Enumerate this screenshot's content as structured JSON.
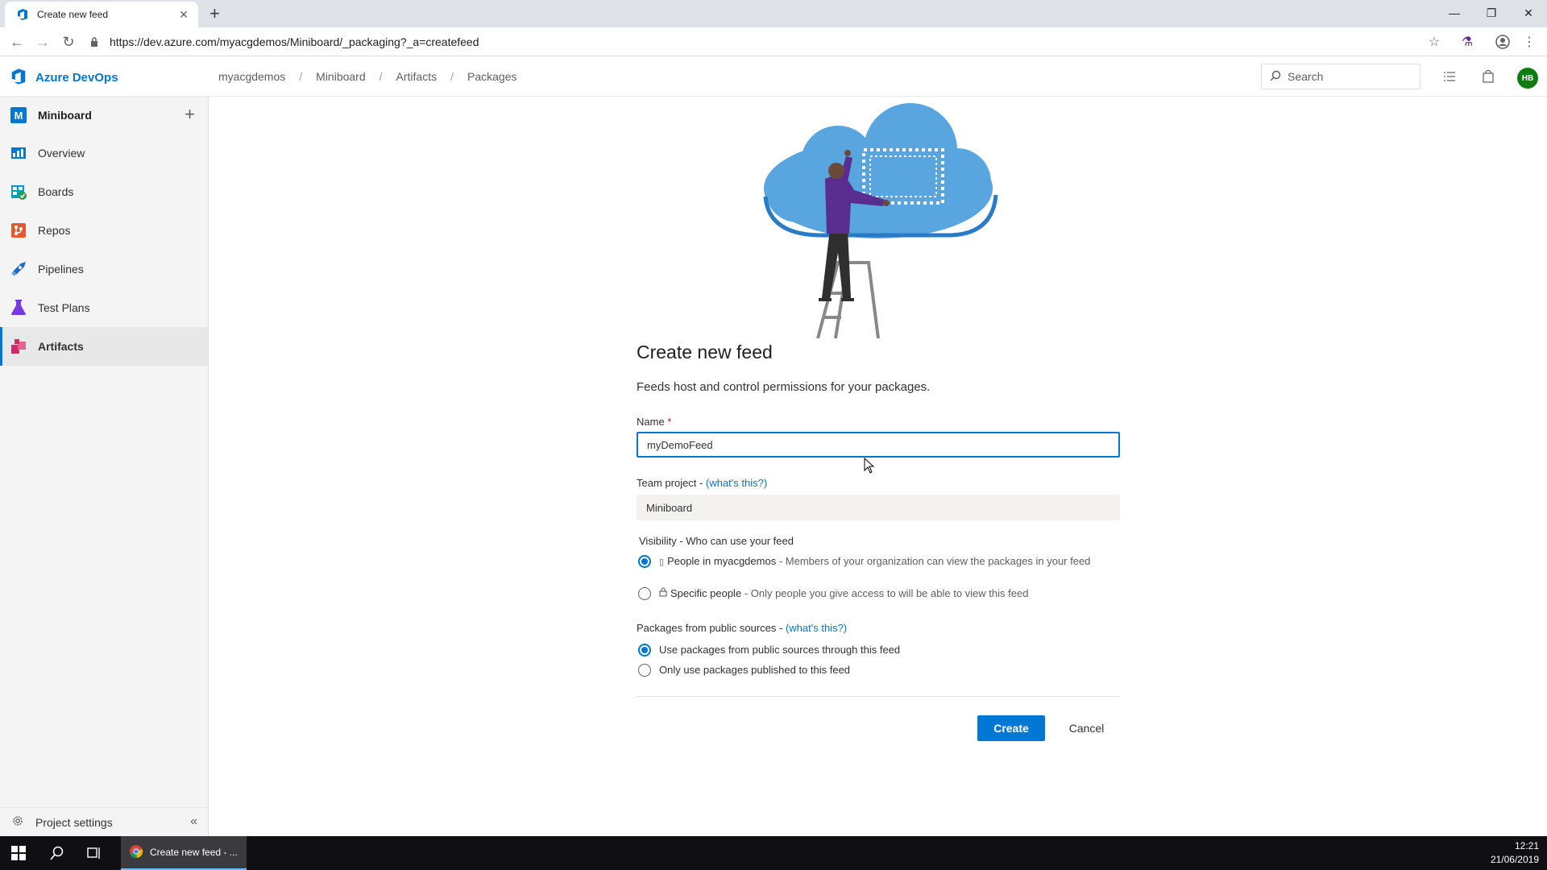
{
  "browser": {
    "tab_title": "Create new feed",
    "url": "https://dev.azure.com/myacgdemos/Miniboard/_packaging?_a=createfeed"
  },
  "header": {
    "product_name": "Azure DevOps",
    "breadcrumb": [
      "myacgdemos",
      "Miniboard",
      "Artifacts",
      "Packages"
    ],
    "search_placeholder": "Search",
    "user_initials": "HB"
  },
  "sidebar": {
    "project_initial": "M",
    "project_name": "Miniboard",
    "items": [
      {
        "label": "Overview",
        "icon": "overview-icon"
      },
      {
        "label": "Boards",
        "icon": "boards-icon"
      },
      {
        "label": "Repos",
        "icon": "repos-icon"
      },
      {
        "label": "Pipelines",
        "icon": "pipelines-icon"
      },
      {
        "label": "Test Plans",
        "icon": "test-plans-icon"
      },
      {
        "label": "Artifacts",
        "icon": "artifacts-icon",
        "selected": true
      }
    ],
    "settings_label": "Project settings"
  },
  "form": {
    "title": "Create new feed",
    "subtitle": "Feeds host and control permissions for your packages.",
    "name_label": "Name",
    "name_required_marker": "*",
    "name_value": "myDemoFeed",
    "team_label": "Team project - ",
    "team_link": "(what's this?)",
    "team_value": "Miniboard",
    "visibility_label": "Visibility - Who can use your feed",
    "visibility_options": [
      {
        "title": "People in myacgdemos",
        "desc": "Members of your organization can view the packages in your feed",
        "checked": true
      },
      {
        "title": "Specific people",
        "desc": "Only people you give access to will be able to view this feed",
        "checked": false
      }
    ],
    "public_label": "Packages from public sources - ",
    "public_link": "(what's this?)",
    "public_options": [
      {
        "label": "Use packages from public sources through this feed",
        "checked": true
      },
      {
        "label": "Only use packages published to this feed",
        "checked": false
      }
    ],
    "create_label": "Create",
    "cancel_label": "Cancel"
  },
  "taskbar": {
    "app_label": "Create new feed - ...",
    "time": "12:21",
    "date": "21/06/2019"
  },
  "colors": {
    "accent": "#0078d4",
    "avatar": "#107c10"
  }
}
